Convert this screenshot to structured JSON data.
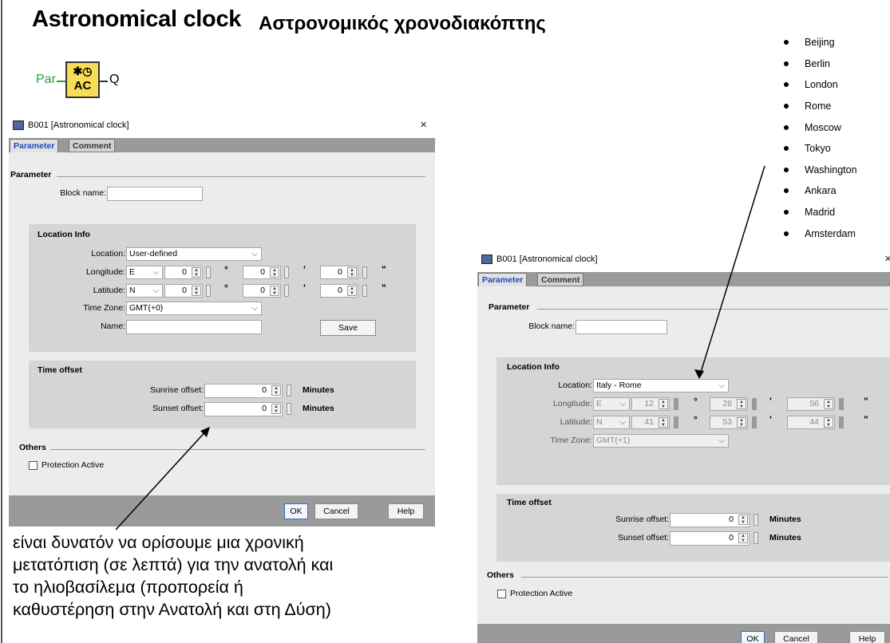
{
  "titles": {
    "english": "Astronomical clock",
    "greek": "Αστρονομικός χρονοδιακόπτης"
  },
  "symbol": {
    "input": "Par",
    "glyph": "✱◷",
    "label": "AC",
    "output": "Q"
  },
  "cities": [
    "Beijing",
    "Berlin",
    "London",
    "Rome",
    "Moscow",
    "Tokyo",
    "Washington",
    "Ankara",
    "Madrid",
    "Amsterdam"
  ],
  "dialog_left": {
    "title": "B001 [Astronomical clock]",
    "close": "×",
    "tabs": [
      "Parameter",
      "Comment"
    ],
    "parameter_section": "Parameter",
    "block_name_label": "Block name:",
    "block_name_value": "",
    "location_info": "Location Info",
    "location_label": "Location:",
    "location_value": "User-defined",
    "longitude_label": "Longitude:",
    "longitude_dir": "E",
    "longitude_values": [
      "0",
      "0",
      "0"
    ],
    "latitude_label": "Latitude:",
    "latitude_dir": "N",
    "latitude_values": [
      "0",
      "0",
      "0"
    ],
    "time_zone_label": "Time Zone:",
    "time_zone_value": "GMT(+0)",
    "name_label": "Name:",
    "name_value": "",
    "save_button": "Save",
    "time_offset": "Time offset",
    "sunrise_label": "Sunrise offset:",
    "sunrise_value": "0",
    "sunset_label": "Sunset offset:",
    "sunset_value": "0",
    "minutes": "Minutes",
    "others": "Others",
    "protection_label": "Protection Active",
    "protection_checked": false,
    "ok": "OK",
    "cancel": "Cancel",
    "help": "Help"
  },
  "dialog_right": {
    "title": "B001 [Astronomical clock]",
    "close": "×",
    "tabs": [
      "Parameter",
      "Comment"
    ],
    "parameter_section": "Parameter",
    "block_name_label": "Block name:",
    "block_name_value": "",
    "location_info": "Location Info",
    "location_label": "Location:",
    "location_value": "Italy - Rome",
    "longitude_label": "Longitude:",
    "longitude_dir": "E",
    "longitude_values": [
      "12",
      "28",
      "56"
    ],
    "latitude_label": "Latitude:",
    "latitude_dir": "N",
    "latitude_values": [
      "41",
      "53",
      "44"
    ],
    "time_zone_label": "Time Zone:",
    "time_zone_value": "GMT(+1)",
    "time_offset": "Time offset",
    "sunrise_label": "Sunrise offset:",
    "sunrise_value": "0",
    "sunset_label": "Sunset offset:",
    "sunset_value": "0",
    "minutes": "Minutes",
    "others": "Others",
    "protection_label": "Protection Active",
    "protection_checked": false,
    "ok": "OK",
    "cancel": "Cancel",
    "help": "Help"
  },
  "units": {
    "degree": "°",
    "minute": "'",
    "second": "\""
  },
  "note": [
    "είναι δυνατόν να ορίσουμε μια χρονική",
    "μετατόπιση (σε λεπτά) για την ανατολή και",
    "το ηλιοβασίλεμα (προπορεία ή",
    "καθυστέρηση στην Ανατολή και στη Δύση)"
  ]
}
